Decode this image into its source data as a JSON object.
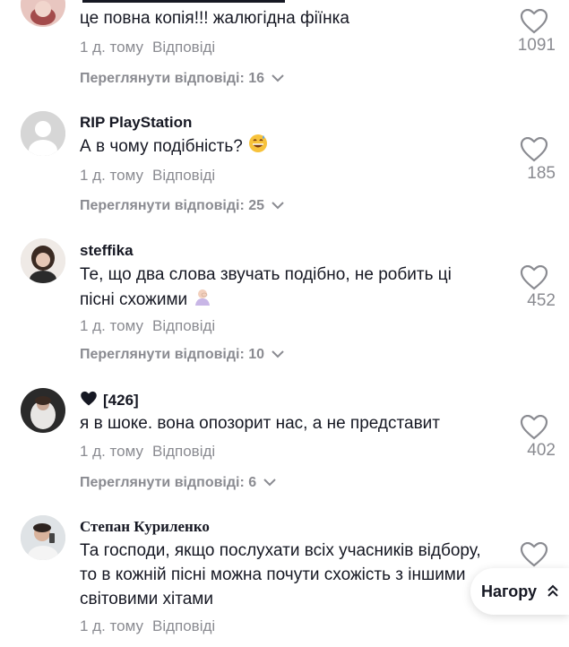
{
  "comments": [
    {
      "username": "",
      "text": "це повна копія!!! жалюгідна фіїнка",
      "time": "1 д. тому",
      "reply": "Відповіді",
      "likes": "1091",
      "view_replies": "Переглянути відповіді: 16"
    },
    {
      "username": "RIP PlayStation",
      "text": "А в чому подібність?",
      "time": "1 д. тому",
      "reply": "Відповіді",
      "likes": "185",
      "view_replies": "Переглянути відповіді: 25"
    },
    {
      "username": "steffika",
      "text": "Те, що два слова звучать подібно, не робить ці пісні схожими",
      "time": "1 д. тому",
      "reply": "Відповіді",
      "likes": "452",
      "view_replies": "Переглянути відповіді: 10"
    },
    {
      "username": "[426]",
      "text": "я в шоке. вона опозорит нас, а не представит",
      "time": "1 д. тому",
      "reply": "Відповіді",
      "likes": "402",
      "view_replies": "Переглянути відповіді: 6"
    },
    {
      "username": "Степан Куриленко",
      "text": "Та господи, якщо послухати всіх учасників відбору, то в кожній пісні можна почути схожість з іншими світовими хітами",
      "time": "1 д. тому",
      "reply": "Відповіді",
      "likes": ""
    }
  ],
  "back_to_top": "Нагору",
  "colors": {
    "text": "#161823",
    "muted": "#8a8b91"
  },
  "icons": [
    "heart-outline-icon",
    "chevron-down-icon",
    "double-chevron-up-icon",
    "black-heart-icon",
    "grinning-sweat-emoji",
    "facepalm-emoji"
  ]
}
